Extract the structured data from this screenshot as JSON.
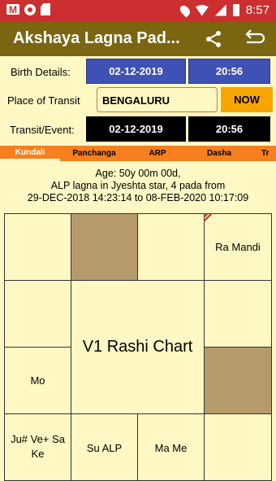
{
  "status_bar": {
    "time": "8:57"
  },
  "app_bar": {
    "title": "Akshaya Lagna Pad..."
  },
  "form": {
    "birth_label": "Birth Details:",
    "birth_date": "02-12-2019",
    "birth_time": "20:56",
    "place_label": "Place of Transit",
    "place_value": "BENGALURU",
    "now_label": "NOW",
    "transit_label": "Transit/Event:",
    "transit_date": "02-12-2019",
    "transit_time": "20:56"
  },
  "tabs": [
    {
      "label": "Kundali"
    },
    {
      "label": "Panchanga"
    },
    {
      "label": "ARP"
    },
    {
      "label": "Dasha"
    },
    {
      "label": "Tr"
    }
  ],
  "info": {
    "line1": "Age: 50y 00m 00d,",
    "line2": "ALP lagna in Jyeshta star, 4 pada from",
    "line3": "29-DEC-2018  14:23:14 to 08-FEB-2020  10:17:09"
  },
  "chart": {
    "title": "V1 Rashi Chart",
    "cells": {
      "r0c3": "Ra Mandi",
      "r2c0": "Mo",
      "r3c0": "Ju# Ve+ Sa Ke",
      "r3c1": "Su ALP",
      "r3c2": "Ma Me"
    }
  },
  "colors": {
    "status_bar": "#cc2f2f",
    "app_bar": "#7c6511",
    "background": "#fff8c4",
    "blue_box": "#3f51b5",
    "tab_bar": "#f77f1f",
    "now_button": "#f9a500",
    "tan_cell": "#b59a6b"
  }
}
